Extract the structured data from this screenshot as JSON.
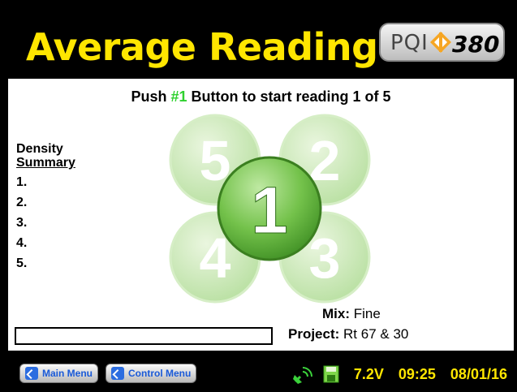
{
  "header": {
    "title": "Average Reading",
    "logo": {
      "left_text": "PQI",
      "right_text": "380"
    }
  },
  "main": {
    "prompt_prefix": "Push ",
    "prompt_highlight": "#1",
    "prompt_suffix": " Button to start reading 1 of 5",
    "summary": {
      "title_line1": "Density",
      "title_line2": "Summary",
      "rows": [
        "1.",
        "2.",
        "3.",
        "4.",
        "5."
      ]
    },
    "reading_buttons": [
      "5",
      "2",
      "1",
      "4",
      "3"
    ],
    "mix_label": "Mix:",
    "mix_value": "Fine",
    "project_label": "Project:",
    "project_value": "Rt 67 & 30",
    "input_value": ""
  },
  "footer": {
    "main_menu": "Main Menu",
    "control_menu": "Control Menu",
    "voltage": "7.2V",
    "time": "09:25",
    "date": "08/01/16"
  },
  "colors": {
    "title": "#ffe600",
    "highlight": "#2fd12f",
    "button_green": "#6cc24a",
    "background": "#000000"
  }
}
